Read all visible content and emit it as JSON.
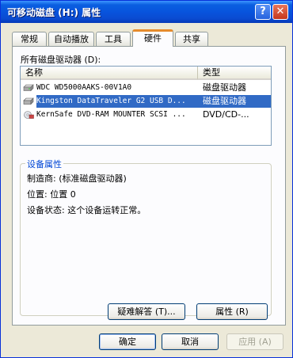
{
  "window": {
    "title": "可移动磁盘 (H:) 属性",
    "help_glyph": "?",
    "close_glyph": "✕"
  },
  "tabs": [
    {
      "label": "常规"
    },
    {
      "label": "自动播放"
    },
    {
      "label": "工具"
    },
    {
      "label": "硬件",
      "active": true
    },
    {
      "label": "共享"
    }
  ],
  "hardware": {
    "list_label": "所有磁盘驱动器 (D):",
    "columns": {
      "name": "名称",
      "type": "类型"
    },
    "rows": [
      {
        "name": "WDC WD5000AAKS-00V1A0",
        "type": "磁盘驱动器",
        "icon": "hard-disk-icon",
        "selected": false
      },
      {
        "name": "Kingston DataTraveler G2 USB D...",
        "type": "磁盘驱动器",
        "icon": "usb-disk-icon",
        "selected": true
      },
      {
        "name": "KernSafe DVD-RAM MOUNTER SCSI ...",
        "type": "DVD/CD-...",
        "icon": "cd-drive-icon",
        "selected": false
      }
    ]
  },
  "device_properties": {
    "title": "设备属性",
    "manufacturer": "制造商: (标准磁盘驱动器)",
    "location": "位置: 位置 0",
    "status": "设备状态: 这个设备运转正常。",
    "troubleshoot_label": "疑难解答 (T)...",
    "properties_label": "属性 (R)"
  },
  "footer": {
    "ok_label": "确定",
    "cancel_label": "取消",
    "apply_label": "应用 (A)"
  },
  "colors": {
    "title_bar": "#0a5fe0",
    "selection": "#316ac5",
    "active_tab_accent": "#e68b2c",
    "group_title": "#0046d5"
  }
}
